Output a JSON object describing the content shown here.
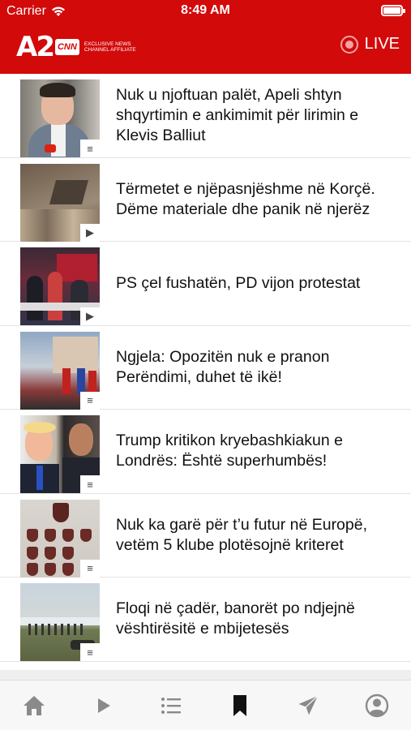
{
  "status_bar": {
    "carrier": "Carrier",
    "time": "8:49 AM"
  },
  "app_bar": {
    "logo_main": "A2",
    "logo_cnn": "CNN",
    "logo_affiliate_line1": "EXCLUSIVE NEWS",
    "logo_affiliate_line2": "CHANNEL AFFILIATE",
    "live_label": "LIVE",
    "brand_color": "#d20a0a"
  },
  "news": [
    {
      "headline": "Nuk u njoftuan palët, Apeli shtyn shqyrtimin e ankimimit për lirimin e Klevis Balliut",
      "media_type": "article-icon"
    },
    {
      "headline": "Tërmetet e njëpasnjëshme në Korçë. Dëme materiale dhe panik në njerëz",
      "media_type": "play-icon"
    },
    {
      "headline": "PS çel fushatën, PD vijon protestat",
      "media_type": "play-icon"
    },
    {
      "headline": "Ngjela: Opozitën nuk e pranon Perëndimi, duhet të ikë!",
      "media_type": "article-icon"
    },
    {
      "headline": "Trump kritikon kryebashkiakun e Londrës: Është superhumbës!",
      "media_type": "article-icon"
    },
    {
      "headline": "Nuk ka garë për t’u futur në Europë, vetëm 5 klube plotësojnë kriteret",
      "media_type": "article-icon"
    },
    {
      "headline": "Floqi në çadër, banorët po ndjejnë vështirësitë e mbijetesës",
      "media_type": "article-icon"
    }
  ],
  "tab_bar": {
    "tabs": [
      "home-icon",
      "play-icon",
      "list-icon",
      "bookmark-icon",
      "send-icon",
      "profile-icon"
    ],
    "active": "bookmark-icon"
  }
}
